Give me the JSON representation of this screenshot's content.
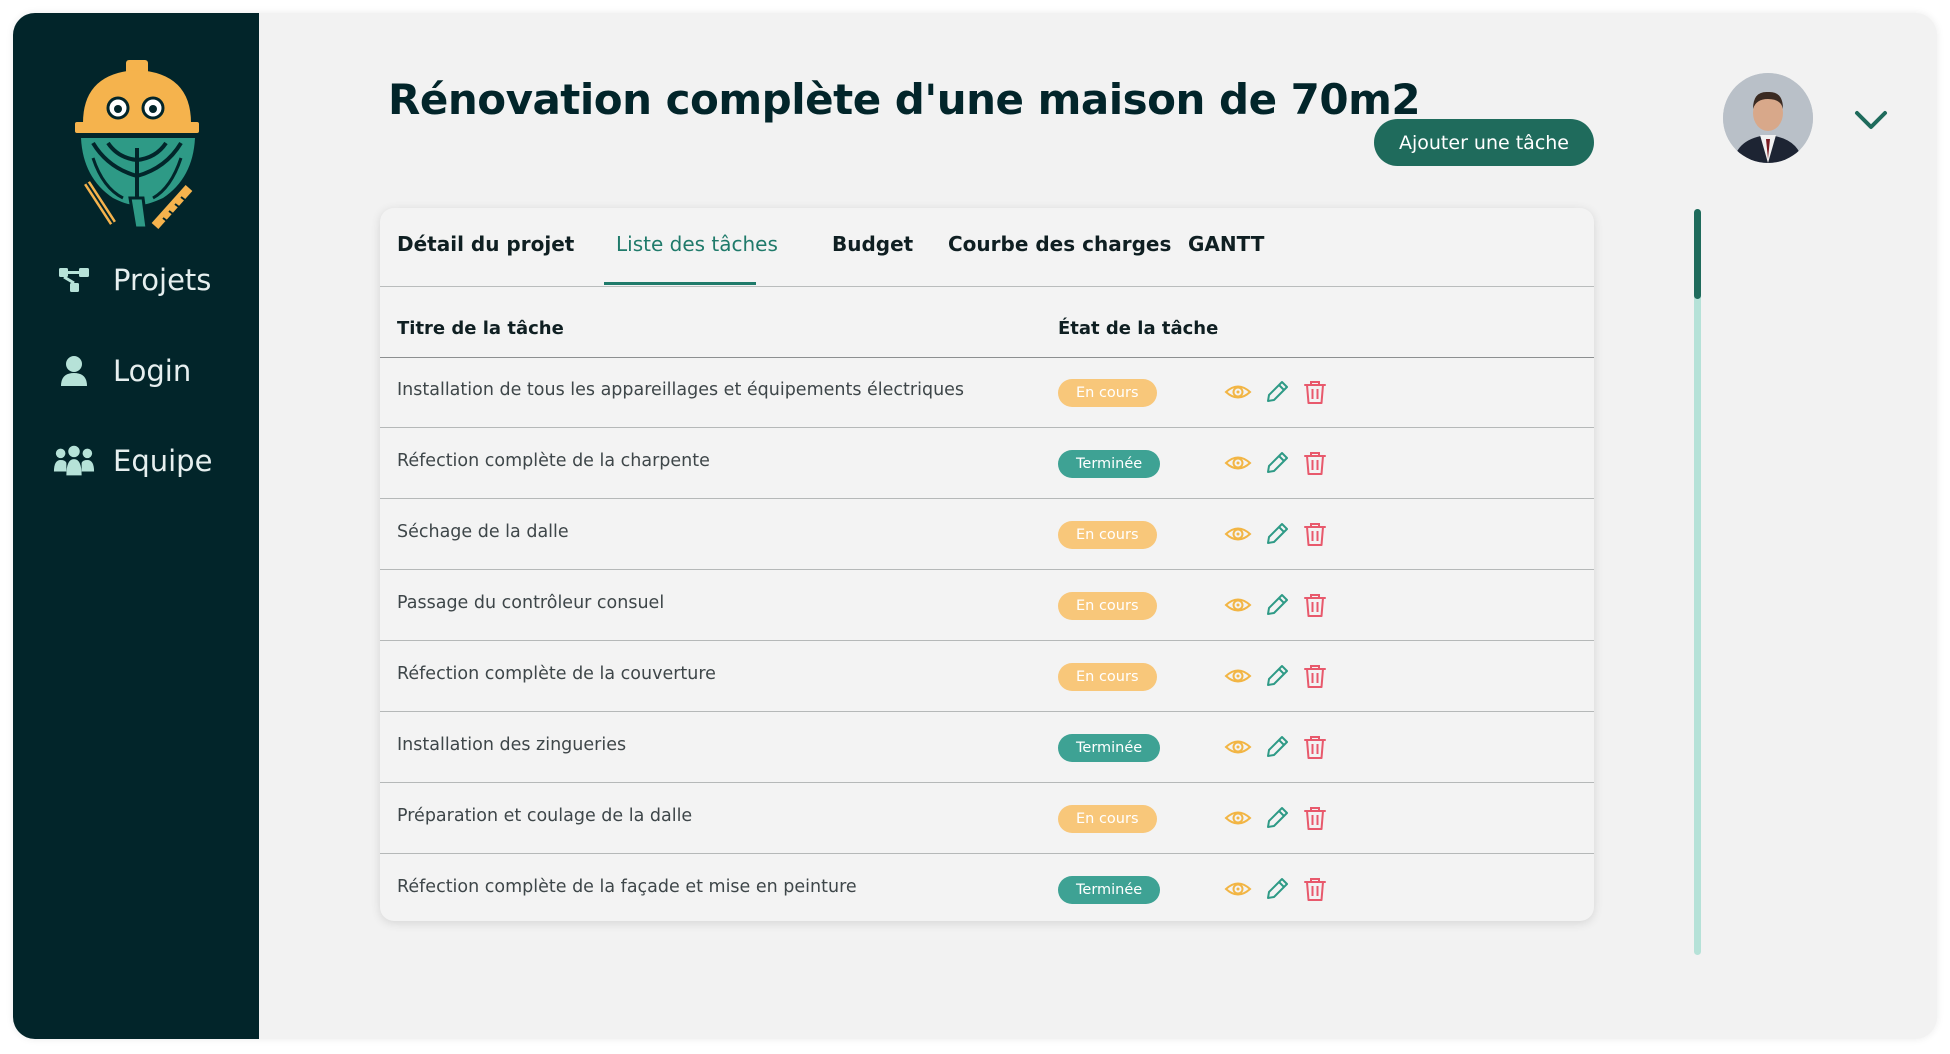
{
  "page": {
    "title": "Rénovation complète d'une maison de 70m2"
  },
  "header": {
    "add_button_label": "Ajouter une tâche",
    "avatar_icon": "user-avatar",
    "menu_icon": "chevron-down-icon"
  },
  "sidebar": {
    "logo": "artichoke-builder-logo",
    "items": [
      {
        "label": "Projets",
        "icon": "project-tree-icon"
      },
      {
        "label": "Login",
        "icon": "user-icon"
      },
      {
        "label": "Equipe",
        "icon": "team-icon"
      }
    ]
  },
  "tabs": [
    {
      "label": "Détail du projet",
      "active": false
    },
    {
      "label": "Liste des tâches",
      "active": true
    },
    {
      "label": "Budget",
      "active": false
    },
    {
      "label": "Courbe des charges",
      "active": false
    },
    {
      "label": "GANTT",
      "active": false
    }
  ],
  "table": {
    "columns": [
      "Titre de la tâche",
      "État de la tâche"
    ],
    "rows": [
      {
        "title": "Installation de tous les appareillages et équipements électriques",
        "status": "En cours"
      },
      {
        "title": "Réfection complète de la charpente",
        "status": "Terminée"
      },
      {
        "title": "Séchage de la dalle",
        "status": "En cours"
      },
      {
        "title": "Passage du contrôleur consuel",
        "status": "En cours"
      },
      {
        "title": "Réfection complète de la couverture",
        "status": "En cours"
      },
      {
        "title": "Installation des zingueries",
        "status": "Terminée"
      },
      {
        "title": "Préparation et coulage de la dalle",
        "status": "En cours"
      },
      {
        "title": "Réfection complète de la façade et mise en peinture",
        "status": "Terminée"
      }
    ],
    "row_actions": [
      "eye-icon",
      "pencil-icon",
      "trash-icon"
    ]
  },
  "colors": {
    "sidebar_bg": "#02252a",
    "primary": "#1f6b5c",
    "status_en_cours": "#f8c77a",
    "status_terminee": "#3ea294",
    "view_icon": "#f2b544",
    "edit_icon": "#2e9a86",
    "delete_icon": "#e8596c"
  }
}
